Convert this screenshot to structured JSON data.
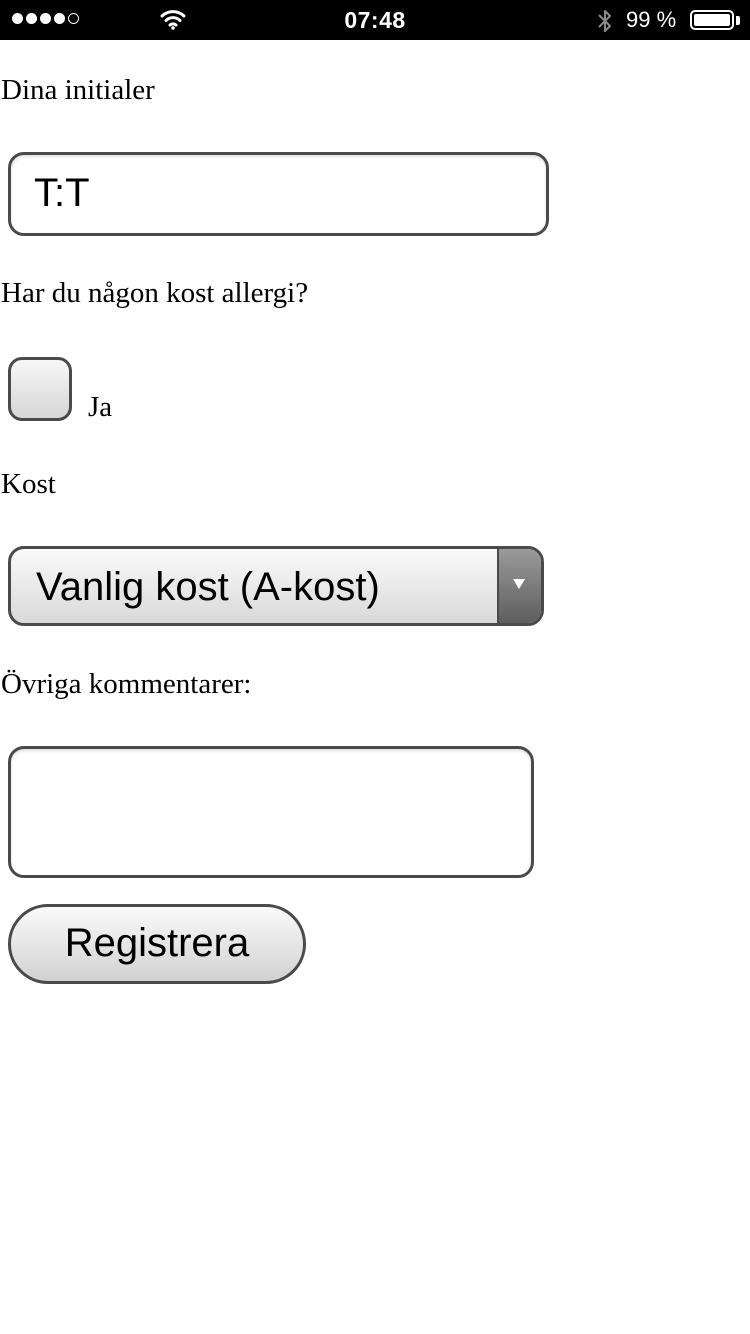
{
  "status_bar": {
    "time": "07:48",
    "battery_percent": "99 %",
    "signal_bars_filled": 4,
    "signal_bars_total": 5,
    "battery_level": 0.99
  },
  "form": {
    "initials_label": "Dina initialer",
    "initials_value": "T:T",
    "allergy_question": "Har du någon kost allergi?",
    "allergy_checkbox_label": "Ja",
    "allergy_checked": false,
    "diet_label": "Kost",
    "diet_selected": "Vanlig kost (A-kost)",
    "comments_label": "Övriga kommentarer:",
    "comments_value": "",
    "submit_label": "Registrera"
  },
  "colors": {
    "status_bar_bg": "#000000",
    "control_border": "#4a4a4a",
    "page_bg": "#ffffff"
  }
}
